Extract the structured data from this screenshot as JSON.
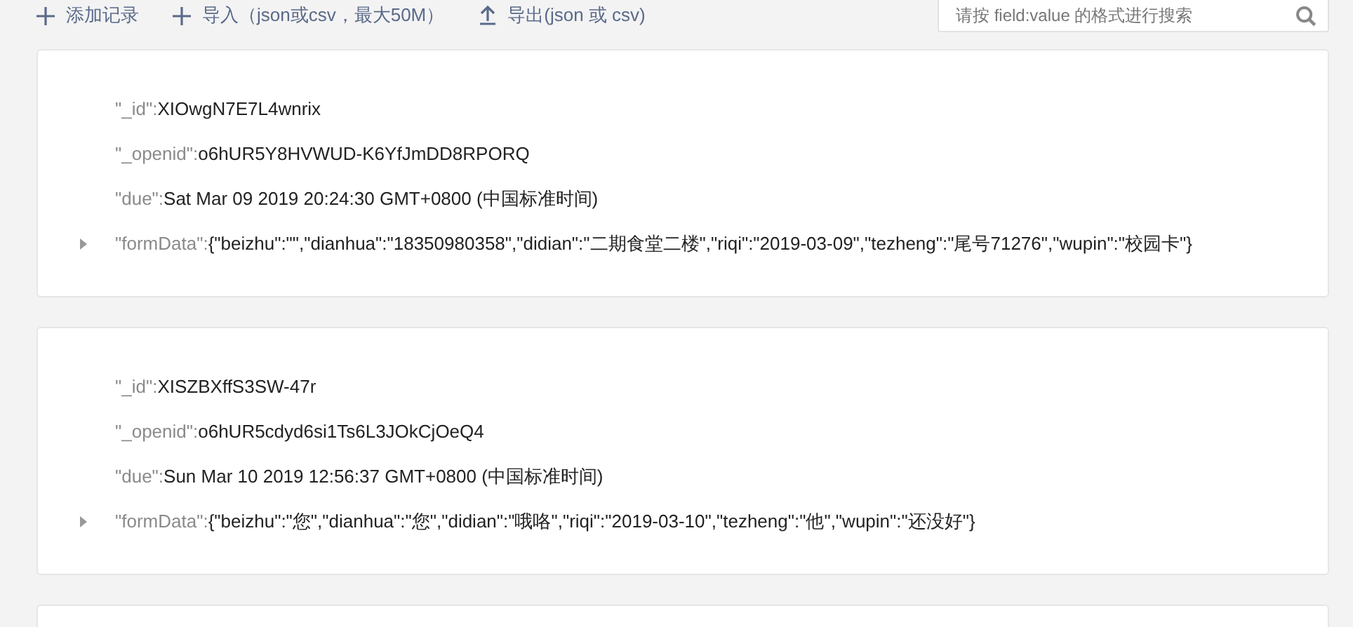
{
  "toolbar": {
    "actions": [
      {
        "kind": "plus",
        "label": "添加记录"
      },
      {
        "kind": "plus",
        "label": "导入（json或csv，最大50M）"
      },
      {
        "kind": "upload",
        "label": "导出(json 或 csv)"
      }
    ],
    "search": {
      "placeholder": "请按 field:value 的格式进行搜索"
    }
  },
  "records": [
    {
      "fields": [
        {
          "key": "\"_id\":",
          "value": "XIOwgN7E7L4wnrix",
          "expandable": false
        },
        {
          "key": "\"_openid\":",
          "value": "o6hUR5Y8HVWUD-K6YfJmDD8RPORQ",
          "expandable": false
        },
        {
          "key": "\"due\":",
          "value": "Sat Mar 09 2019 20:24:30 GMT+0800 (中国标准时间)",
          "expandable": false
        },
        {
          "key": "\"formData\":",
          "value": "{\"beizhu\":\"\",\"dianhua\":\"18350980358\",\"didian\":\"二期食堂二楼\",\"riqi\":\"2019-03-09\",\"tezheng\":\"尾号71276\",\"wupin\":\"校园卡\"}",
          "expandable": true
        }
      ]
    },
    {
      "fields": [
        {
          "key": "\"_id\":",
          "value": "XISZBXffS3SW-47r",
          "expandable": false
        },
        {
          "key": "\"_openid\":",
          "value": "o6hUR5cdyd6si1Ts6L3JOkCjOeQ4",
          "expandable": false
        },
        {
          "key": "\"due\":",
          "value": "Sun Mar 10 2019 12:56:37 GMT+0800 (中国标准时间)",
          "expandable": false
        },
        {
          "key": "\"formData\":",
          "value": "{\"beizhu\":\"您\",\"dianhua\":\"您\",\"didian\":\"哦咯\",\"riqi\":\"2019-03-10\",\"tezheng\":\"他\",\"wupin\":\"还没好\"}",
          "expandable": true
        }
      ]
    }
  ]
}
